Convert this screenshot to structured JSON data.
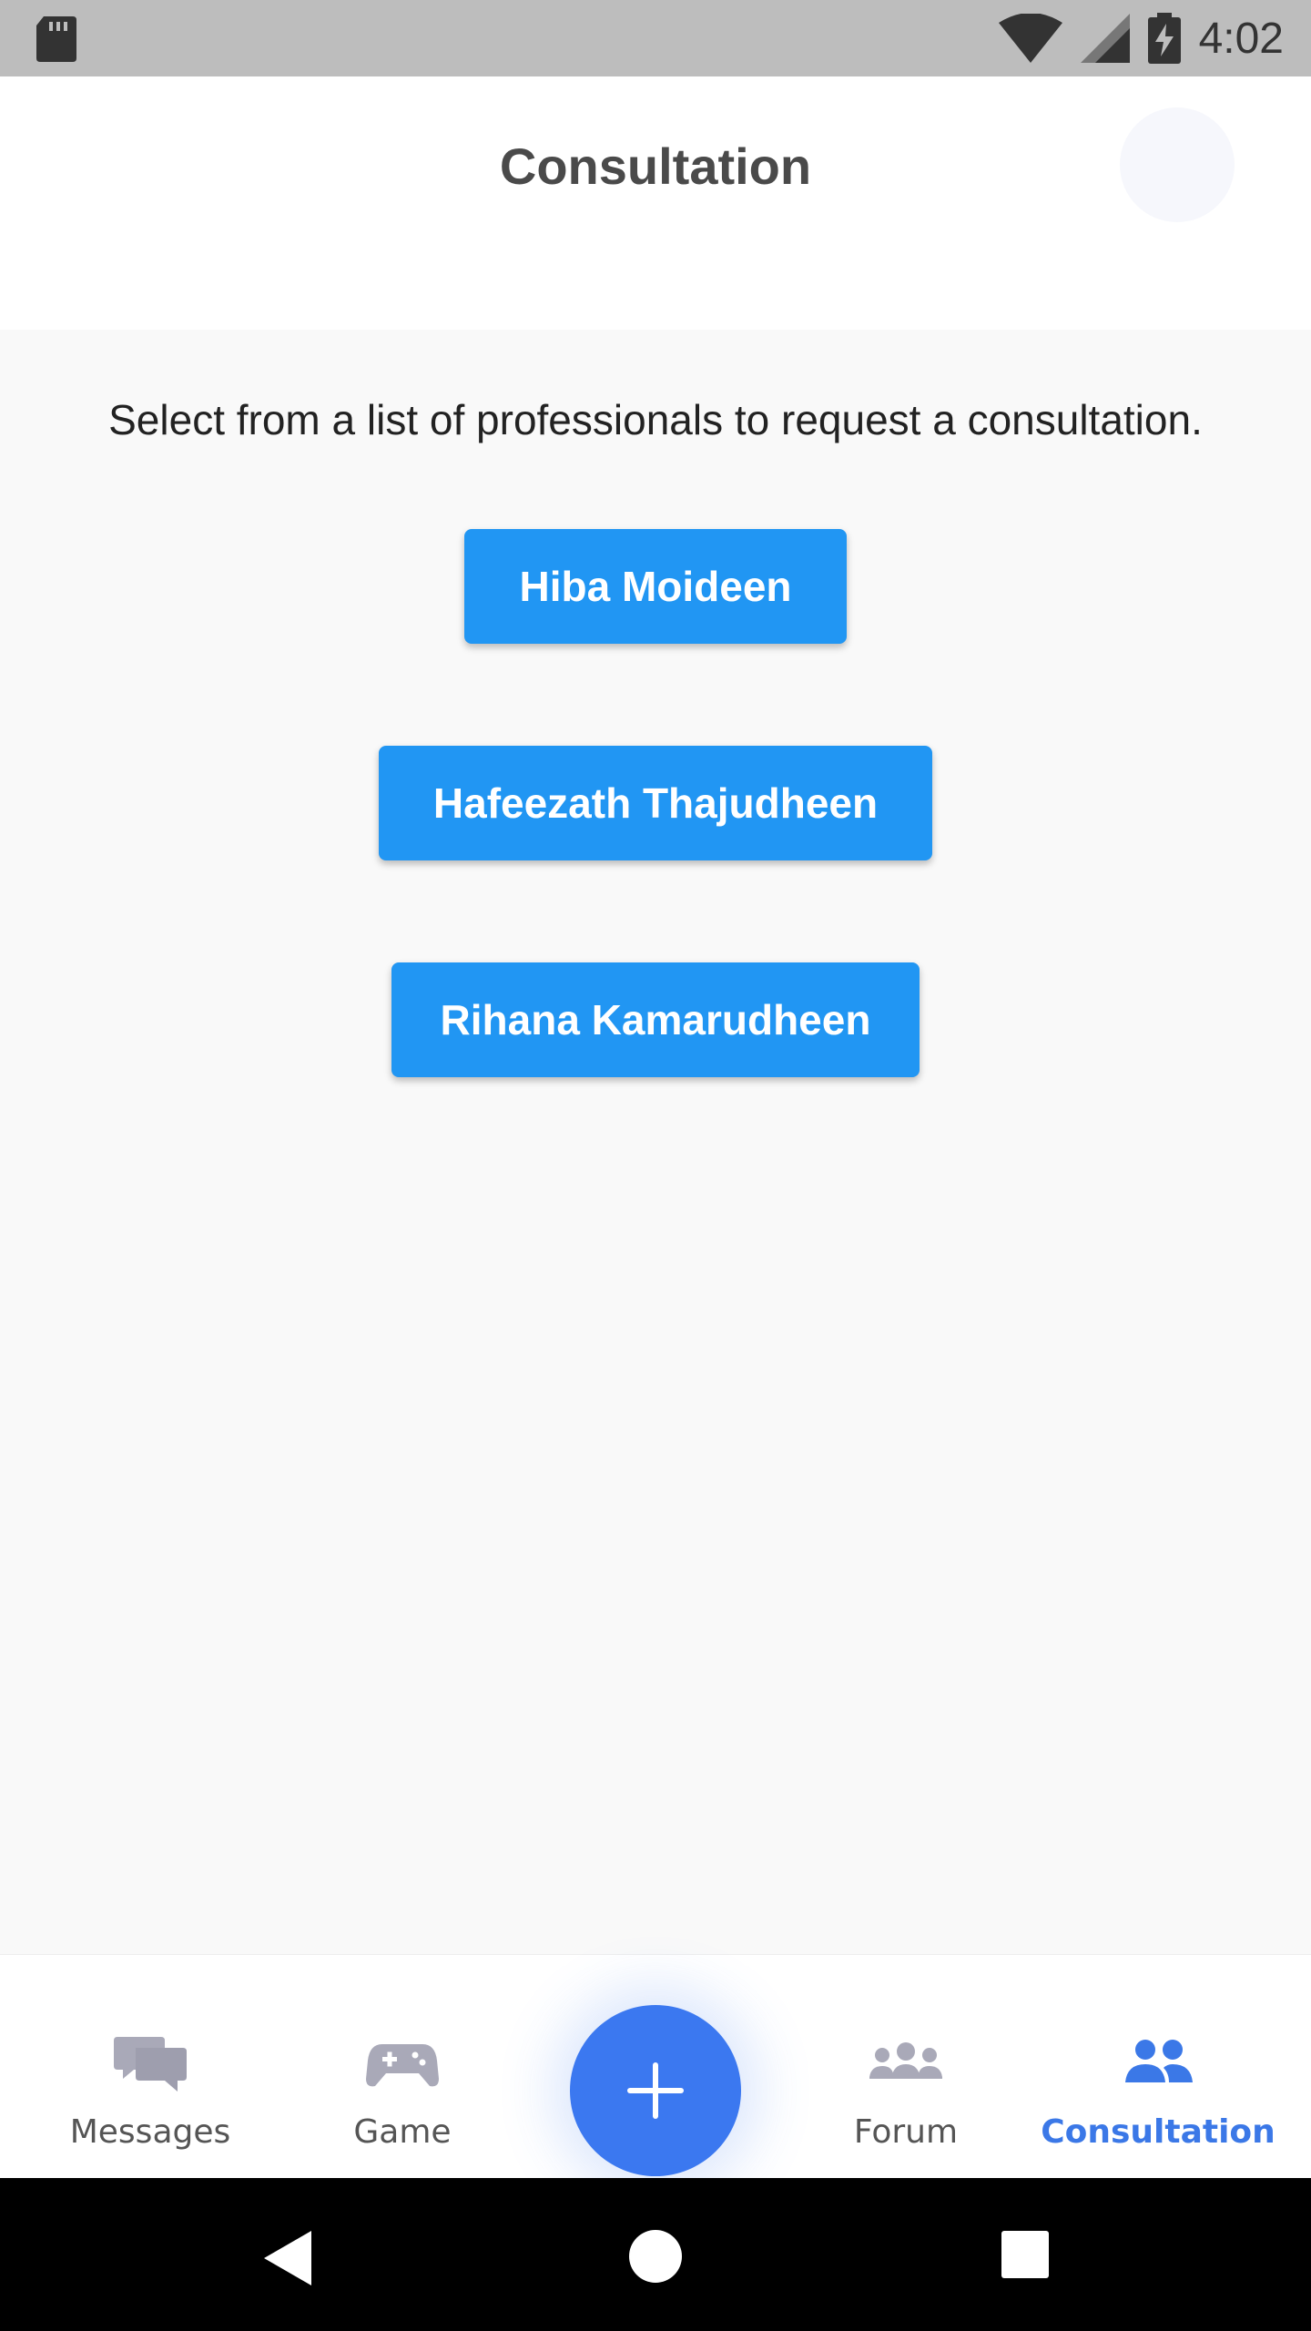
{
  "status_bar": {
    "time": "4:02",
    "icons": [
      "sd-card-icon",
      "wifi-icon",
      "cell-signal-icon",
      "battery-charging-icon"
    ]
  },
  "header": {
    "title": "Consultation",
    "profile_icon": "avatar"
  },
  "main": {
    "instruction": "Select from a list of professionals to request a consultation.",
    "professionals": [
      "Hiba Moideen",
      "Hafeezath Thajudheen",
      "Rihana Kamarudheen"
    ]
  },
  "bottom_nav": {
    "items": [
      {
        "label": "Messages",
        "icon": "chat-bubbles-icon",
        "active": false
      },
      {
        "label": "Game",
        "icon": "gamepad-icon",
        "active": false
      },
      {
        "label": "Forum",
        "icon": "group-icon",
        "active": false
      },
      {
        "label": "Consultation",
        "icon": "people-icon",
        "active": true
      }
    ],
    "fab_icon": "plus-icon"
  },
  "system_nav": {
    "icons": [
      "back-icon",
      "home-icon",
      "recents-icon"
    ]
  },
  "colors": {
    "button_blue": "#2196f3",
    "fab_blue": "#3b78f0",
    "active_nav": "#3b78e7",
    "inactive_icon": "#a9a9b8"
  }
}
